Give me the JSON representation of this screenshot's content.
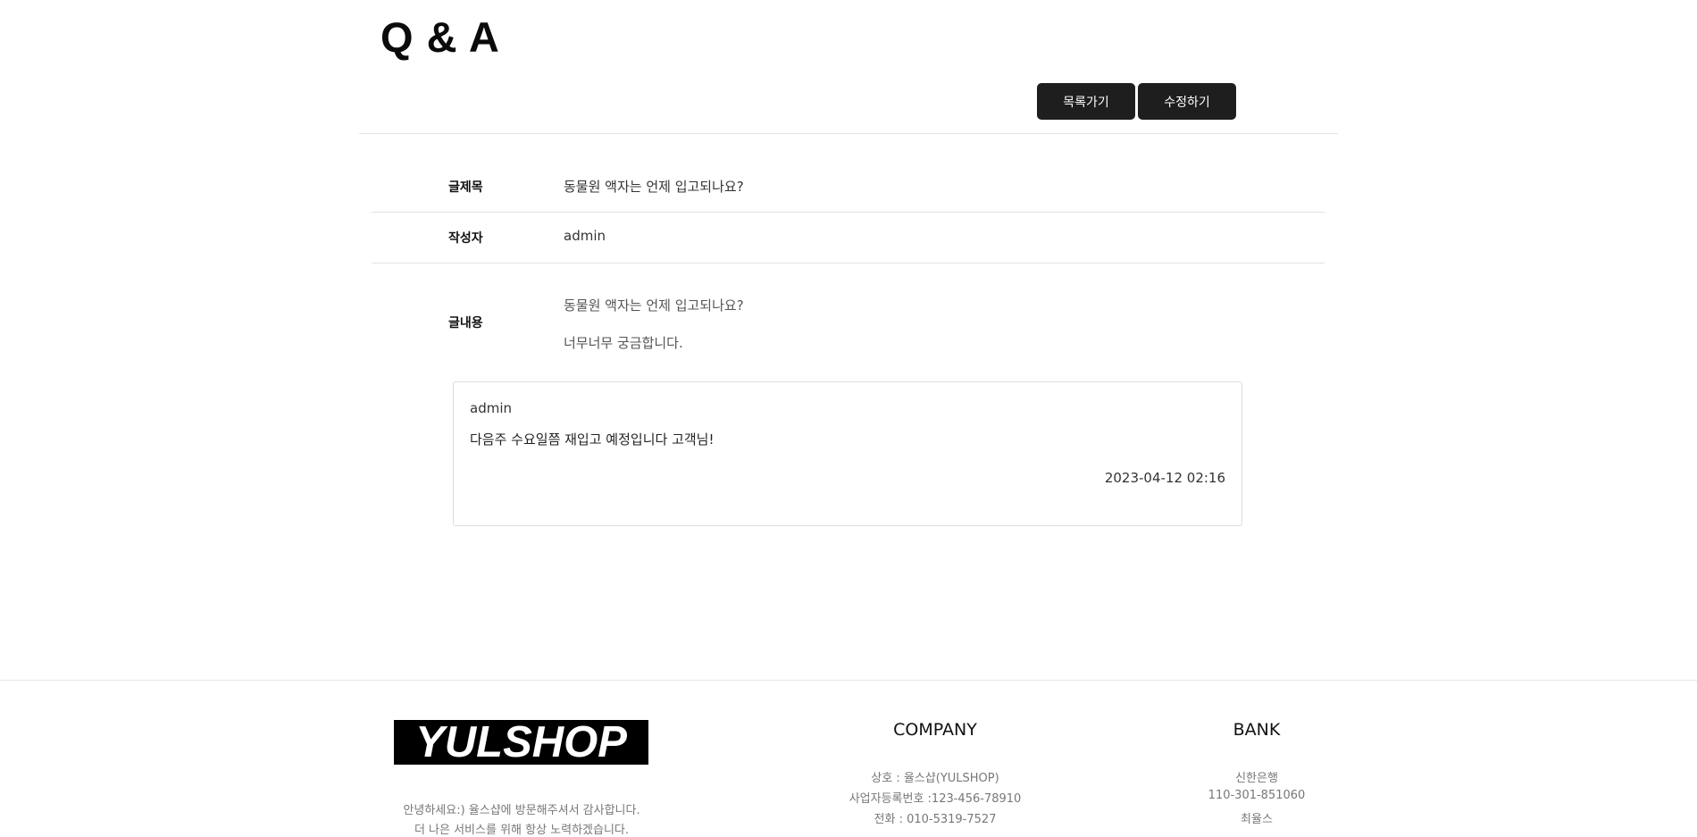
{
  "header": {
    "title": "Q & A",
    "list_button": "목록가기",
    "edit_button": "수정하기"
  },
  "post": {
    "title_label": "글제목",
    "title_value": "동물원 액자는 언제 입고되나요?",
    "author_label": "작성자",
    "author_value": "admin",
    "content_label": "글내용",
    "content_lines": [
      "동물원 액자는 언제 입고되나요?",
      "너무너무 궁금합니다."
    ]
  },
  "comment": {
    "author": "admin",
    "text": "다음주 수요일쯤 재입고 예정입니다 고객님!",
    "date": "2023-04-12 02:16"
  },
  "footer": {
    "logo_text": "YULSHOP",
    "intro_lines": [
      "안녕하세요:) 율스샵에 방문해주셔서 감사합니다.",
      "더 나은 서비스를 위해 항상 노력하겠습니다."
    ],
    "company": {
      "heading": "COMPANY",
      "lines": [
        "상호 : 율스샵(YULSHOP)",
        "사업자등록번호 :123-456-78910",
        "전화 : 010-5319-7527"
      ]
    },
    "bank": {
      "heading": "BANK",
      "lines": [
        "신한은행",
        "110-301-851060",
        "최율스"
      ]
    }
  }
}
